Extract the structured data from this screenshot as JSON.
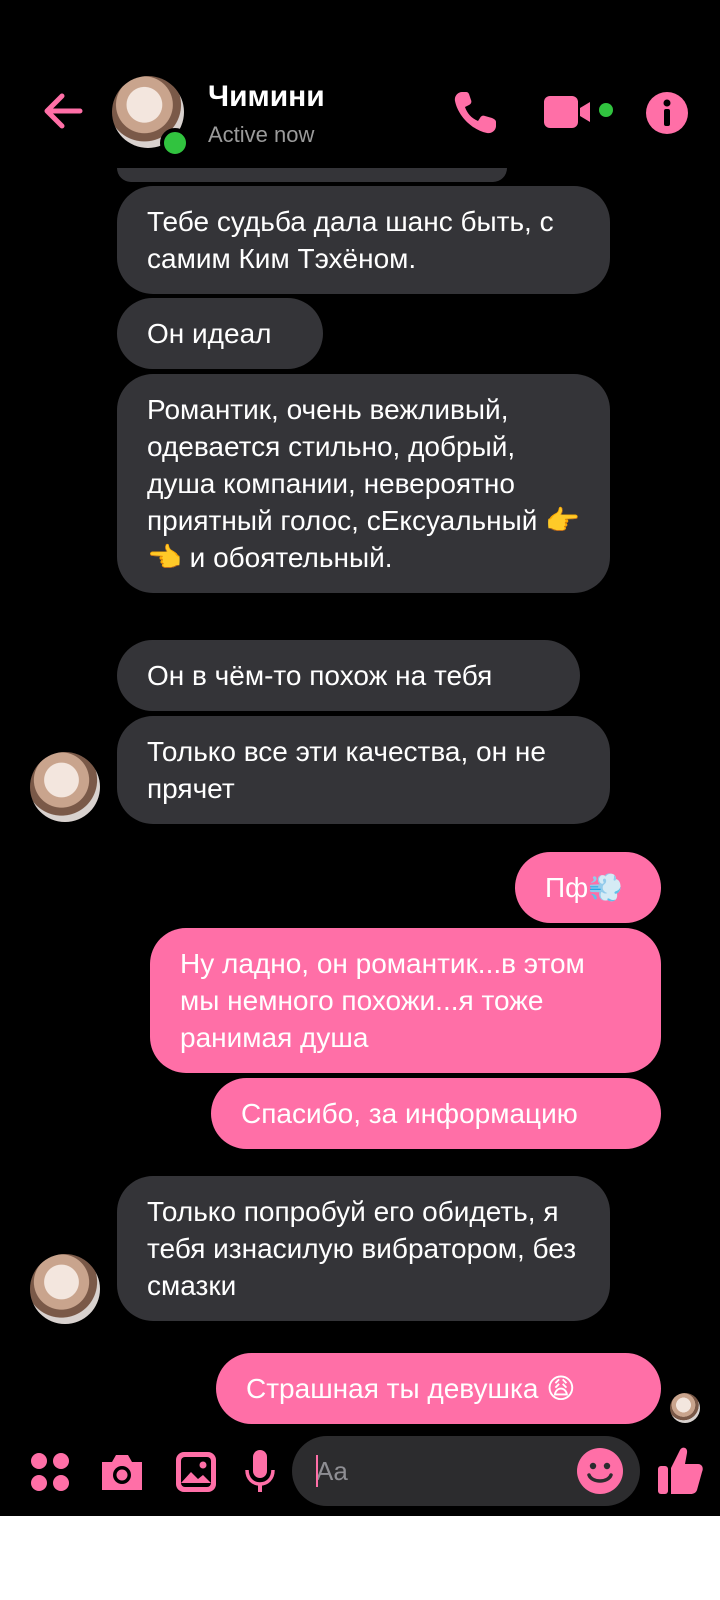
{
  "header": {
    "contact_name": "Чимини",
    "status": "Active now",
    "back_icon": "arrow-left-icon",
    "call_icon": "phone-icon",
    "video_icon": "video-camera-icon",
    "info_icon": "info-icon"
  },
  "messages": [
    {
      "side": "in",
      "text": "Тебе судьба дала шанс быть, с самим Ким Тэхёном."
    },
    {
      "side": "in",
      "text": "Он идеал"
    },
    {
      "side": "in",
      "text": "Романтик, очень вежливый, одевается стильно, добрый, душа компании, невероятно приятный голос, сЕксуальный 👉👈 и обоятельный."
    },
    {
      "side": "in",
      "text": "Он в чём-то похож на тебя"
    },
    {
      "side": "in",
      "text": "Только все эти качества, он не прячет"
    },
    {
      "side": "out",
      "text": "Пф💨"
    },
    {
      "side": "out",
      "text": "Ну ладно, он романтик...в этом мы немного похожи...я тоже ранимая душа"
    },
    {
      "side": "out",
      "text": "Спасибо, за информацию"
    },
    {
      "side": "in",
      "text": "Только попробуй его обидеть, я тебя изнасилую вибратором, без смазки"
    },
    {
      "side": "out",
      "text": "Страшная ты девушка 😩"
    }
  ],
  "composer": {
    "placeholder": "Aa",
    "menu_icon": "four-dots-icon",
    "camera_icon": "camera-icon",
    "gallery_icon": "image-icon",
    "mic_icon": "microphone-icon",
    "emoji_icon": "smiley-icon",
    "like_icon": "thumbs-up-icon"
  },
  "colors": {
    "accent": "#ff6fa7",
    "incoming_bubble": "#343438",
    "background": "#000000",
    "online": "#31c33f"
  }
}
